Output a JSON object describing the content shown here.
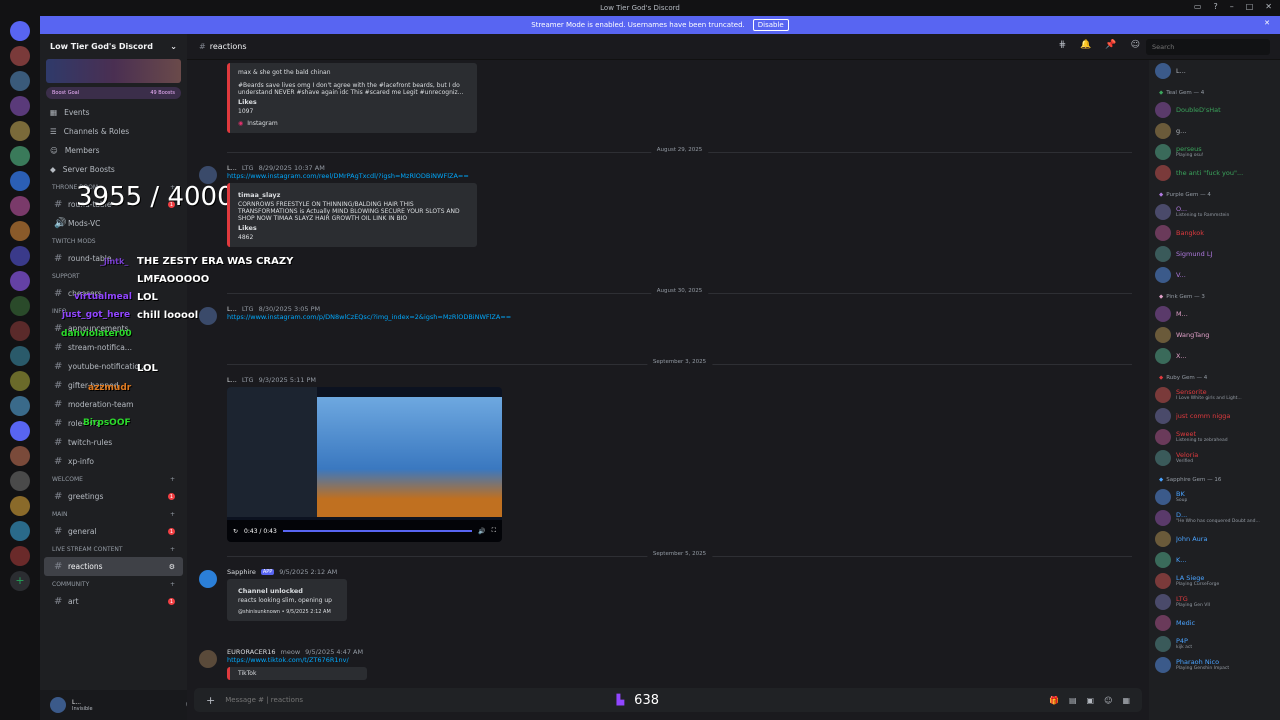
{
  "window": {
    "title": "Low Tier God's Discord"
  },
  "streamer_bar": {
    "text": "Streamer Mode is enabled. Usernames have been truncated.",
    "button": "Disable"
  },
  "colors": {
    "accent": "#5865f2",
    "link": "#00a8fc",
    "danger": "#f23f43",
    "online": "#23a55a"
  },
  "server": {
    "name": "Low Tier God's Discord",
    "boost_goal": "Boost Goal",
    "boosts": "49 Boosts",
    "nav": [
      {
        "label": "Events",
        "icon": "calendar-icon"
      },
      {
        "label": "Channels & Roles",
        "icon": "list-icon"
      },
      {
        "label": "Members",
        "icon": "members-icon"
      },
      {
        "label": "Server Boosts",
        "icon": "boost-icon"
      }
    ],
    "categories": {
      "throne": "THRONE ROOM",
      "twitch_mods": "TWITCH MODS",
      "support": "SUPPORT",
      "info": "INFO",
      "welcome": "WELCOME",
      "main": "MAIN",
      "live": "LIVE STREAM CONTENT",
      "community": "COMMUNITY"
    },
    "channels": {
      "round_table": "round-table",
      "mods_vc": "Mods-VC",
      "round_table2": "round-table",
      "cheesers": "cheesers",
      "announcements": "announcements",
      "stream_notif": "stream-notifica...",
      "youtube_notif": "youtube-notificatio...",
      "gifter_banned": "gifter-banned",
      "moderation": "moderation-team",
      "role_info": "role-info",
      "twitch_rules": "twitch-rules",
      "xp_info": "xp-info",
      "greetings": "greetings",
      "general": "general",
      "reactions": "reactions",
      "art": "art"
    }
  },
  "overlay": {
    "counter": "3955 / 4000",
    "chat_zesty": "THE ZESTY ERA WAS CRAZY",
    "chat_lmfao": "LMFAOOOOO",
    "chat_lol": "LOL",
    "chat_chill": "chill looool",
    "chat_lol2": "LOL",
    "user1": "_jintk_",
    "user2": "virtualmeal",
    "user3": "just_got_here",
    "user4": "dahviolater00",
    "user5": "azzmudr",
    "user6": "BirpsOOF",
    "viewer_count": "638"
  },
  "channel": {
    "name": "reactions",
    "search_placeholder": "Search"
  },
  "messages": {
    "m0_line1": "max & she got the bald chinan",
    "m0_line2": "#Beards save lives omg I don't agree with the #lacefront beards, but I do understand NEVER #shave again idc This #scared me Legit #unrecogniz...",
    "m0_likes_label": "Likes",
    "m0_likes": "1097",
    "m0_source": "Instagram",
    "date1": "August 29, 2025",
    "m1_name": "L...",
    "m1_tag": "LTG",
    "m1_time": "8/29/2025 10:37 AM",
    "m1_link": "https://www.instagram.com/reel/DMrPAgTxcdl/?igsh=MzRlODBiNWFlZA==",
    "m1_author": "timaa_slayz",
    "m1_text": "CORNROWS FREESTYLE ON THINNING/BALDING HAIR THIS TRANSFORMATIONS is Actually MIND BLOWING SECURE YOUR SLOTS AND SHOP NOW TIMAA SLAYZ HAIR GROWTH OIL LINK IN BIO",
    "m1_likes_label": "Likes",
    "m1_likes": "4862",
    "date2": "August 30, 2025",
    "m2_name": "L...",
    "m2_tag": "LTG",
    "m2_time": "8/30/2025 3:05 PM",
    "m2_link": "https://www.instagram.com/p/DN8wlCzEQsc/?img_index=2&igsh=MzRlODBiNWFlZA==",
    "date3": "September 3, 2025",
    "m3_name": "L...",
    "m3_tag": "LTG",
    "m3_time": "9/3/2025 5:11 PM",
    "video_time": "0:43 / 0:43",
    "date4": "September 5, 2025",
    "m4_name": "Sapphire",
    "m4_app": "APP",
    "m4_time": "9/5/2025 2:12 AM",
    "m4_title": "Channel unlocked",
    "m4_text": "reacts looking slim, opening up",
    "m4_footer": "@shinisunknown • 9/5/2025 2:12 AM",
    "m5_name": "EURORACER16",
    "m5_tag": "meow",
    "m5_time": "9/5/2025 4:47 AM",
    "m5_link": "https://www.tiktok.com/t/ZT676R1nv/",
    "m5_source": "TikTok"
  },
  "composer": {
    "placeholder": "Message # | reactions"
  },
  "user": {
    "name": "L...",
    "status": "Invisible"
  },
  "members": {
    "top": {
      "name": "L...",
      "color": "#b5bac1"
    },
    "teal": {
      "label": "Teal Gem — 4",
      "list": [
        {
          "name": "DoubleD'sHat",
          "status": "",
          "color": "#3ba55c"
        },
        {
          "name": "g...",
          "status": "",
          "color": "#b5bac1"
        },
        {
          "name": "perseus",
          "status": "Playing osu!",
          "color": "#3ba55c"
        },
        {
          "name": "the anti \"fuck you\"...",
          "status": "",
          "color": "#3ba55c"
        }
      ]
    },
    "purple": {
      "label": "Purple Gem — 4",
      "list": [
        {
          "name": "O...",
          "status": "Listening to Rammstein",
          "color": "#b07ae0"
        },
        {
          "name": "Bangkok",
          "status": "",
          "color": "#e03a3e"
        },
        {
          "name": "Sigmund LJ",
          "status": "",
          "color": "#b07ae0"
        },
        {
          "name": "V...",
          "status": "",
          "color": "#b07ae0"
        }
      ]
    },
    "pink": {
      "label": "Pink Gem — 3",
      "list": [
        {
          "name": "M...",
          "status": "",
          "color": "#e0a0c8"
        },
        {
          "name": "WangTang",
          "status": "",
          "color": "#e0a0c8"
        },
        {
          "name": "X...",
          "status": "",
          "color": "#e0a0c8"
        }
      ]
    },
    "ruby": {
      "label": "Ruby Gem — 4",
      "list": [
        {
          "name": "Sensorite",
          "status": "I Love White girls and Light...",
          "color": "#e03a3e"
        },
        {
          "name": "just comm nigga",
          "status": "",
          "color": "#e03a3e"
        },
        {
          "name": "Sweet",
          "status": "Listening to zebrahead",
          "color": "#e03a3e"
        },
        {
          "name": "Veloria",
          "status": "Verified",
          "color": "#e03a3e"
        }
      ]
    },
    "sapphire": {
      "label": "Sapphire Gem — 16",
      "list": [
        {
          "name": "BK",
          "status": "Soup",
          "color": "#4aa3ff"
        },
        {
          "name": "D...",
          "status": "\"He Who has conquered Doubt and...",
          "color": "#4aa3ff"
        },
        {
          "name": "John Aura",
          "status": "",
          "color": "#4aa3ff"
        },
        {
          "name": "K...",
          "status": "",
          "color": "#4aa3ff"
        },
        {
          "name": "LA Siege",
          "status": "Playing CurseForge",
          "color": "#4aa3ff"
        },
        {
          "name": "LTG",
          "status": "Playing Gen VII",
          "color": "#e03a3e"
        },
        {
          "name": "Medic",
          "status": "",
          "color": "#4aa3ff"
        },
        {
          "name": "P4P",
          "status": "kijk act",
          "color": "#4aa3ff"
        },
        {
          "name": "Pharaoh Nico",
          "status": "Playing Genshin Impact",
          "color": "#4aa3ff"
        }
      ]
    }
  }
}
